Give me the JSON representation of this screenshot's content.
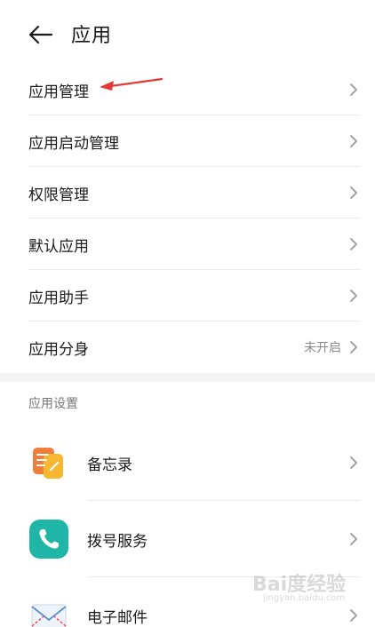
{
  "header": {
    "title": "应用",
    "back_icon": "back-arrow-icon"
  },
  "menu": {
    "items": [
      {
        "label": "应用管理",
        "status": ""
      },
      {
        "label": "应用启动管理",
        "status": ""
      },
      {
        "label": "权限管理",
        "status": ""
      },
      {
        "label": "默认应用",
        "status": ""
      },
      {
        "label": "应用助手",
        "status": ""
      },
      {
        "label": "应用分身",
        "status": "未开启"
      }
    ]
  },
  "settings_section": {
    "title": "应用设置",
    "apps": [
      {
        "label": "备忘录",
        "icon": "notepad-icon",
        "color": "#f5a623"
      },
      {
        "label": "拨号服务",
        "icon": "phone-icon",
        "color": "#1fb6a8"
      },
      {
        "label": "电子邮件",
        "icon": "mail-icon",
        "color": "#e8eef7"
      }
    ]
  },
  "annotation": {
    "arrow_color": "#e53935"
  },
  "watermark": {
    "main": "Bai度经验",
    "sub": "jingyan.baidu.com"
  }
}
